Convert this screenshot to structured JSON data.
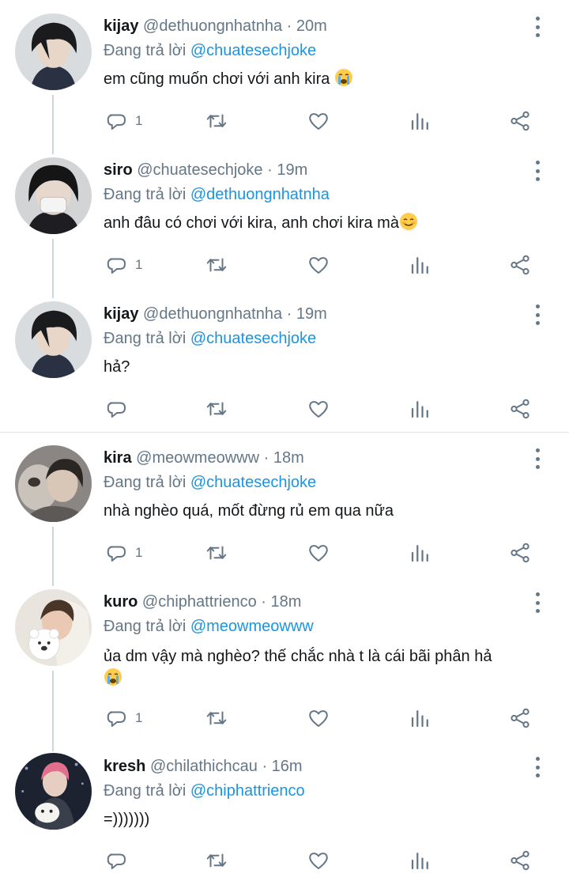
{
  "reply_prefix": "Đang trả lời",
  "tweets": [
    {
      "name": "kijay",
      "handle": "@dethuongnhatnha",
      "time": "20m",
      "reply_to": "@chuatesechjoke",
      "text": "em cũng muốn chơi với anh kira",
      "emoji": "loudly-crying-face",
      "reply_count": "1"
    },
    {
      "name": "siro",
      "handle": "@chuatesechjoke",
      "time": "19m",
      "reply_to": "@dethuongnhatnha",
      "text": "anh đâu có chơi với kira, anh chơi kira mà",
      "emoji": "smiling-face",
      "reply_count": "1"
    },
    {
      "name": "kijay",
      "handle": "@dethuongnhatnha",
      "time": "19m",
      "reply_to": "@chuatesechjoke",
      "text": "hả?",
      "reply_count": ""
    },
    {
      "name": "kira",
      "handle": "@meowmeowww",
      "time": "18m",
      "reply_to": "@chuatesechjoke",
      "text": "nhà nghèo quá, mốt đừng rủ em qua nữa",
      "reply_count": "1"
    },
    {
      "name": "kuro",
      "handle": "@chiphattrienco",
      "time": "18m",
      "reply_to": "@meowmeowww",
      "text": "ủa dm vậy mà nghèo? thế chắc nhà t là cái bãi phân hả",
      "emoji": "loudly-crying-face",
      "reply_count": "1"
    },
    {
      "name": "kresh",
      "handle": "@chilathichcau",
      "time": "16m",
      "reply_to": "@chiphattrienco",
      "text": "=)))))))",
      "reply_count": ""
    }
  ],
  "icons": {
    "reply": "speech-bubble-icon",
    "retweet": "retweet-icon",
    "like": "heart-icon",
    "stats": "bar-chart-icon",
    "share": "share-icon",
    "more": "three-dots-icon"
  },
  "colors": {
    "name": "#14171a",
    "secondary": "#657786",
    "mention": "#1b95e0",
    "thread_line": "#ccd6dd"
  }
}
